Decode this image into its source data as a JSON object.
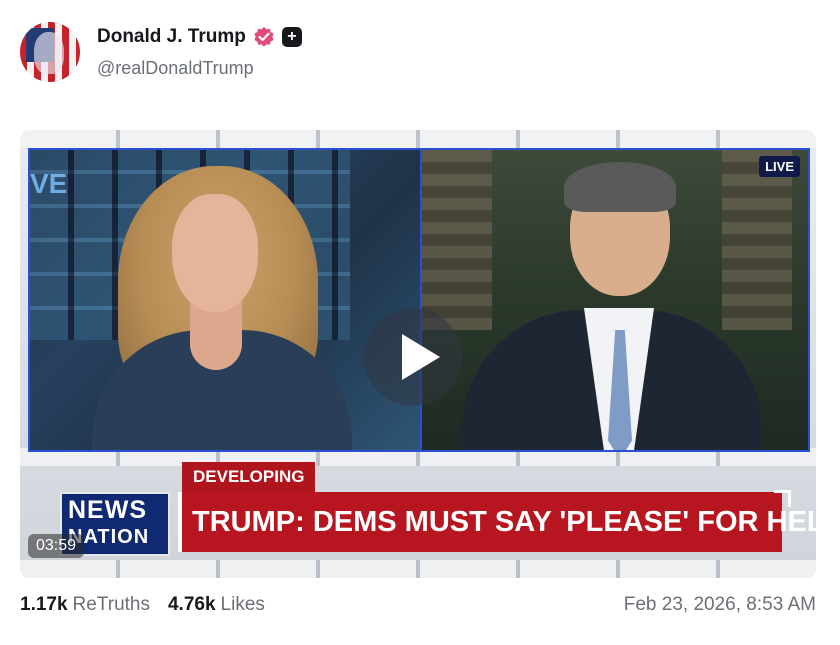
{
  "author": {
    "display_name": "Donald J. Trump",
    "handle": "@realDonaldTrump",
    "verified_icon": "verified-badge-icon",
    "plus_icon": "plus-badge-icon",
    "plus_symbol": "+"
  },
  "video": {
    "duration": "03:59",
    "live_label": "LIVE",
    "logo_line1": "NEWS",
    "logo_line2": "NATION",
    "tag": "DEVELOPING STORY",
    "headline": "TRUMP: DEMS MUST SAY 'PLEASE' FOR HELP",
    "screen_text": "VE",
    "play_icon": "play-icon"
  },
  "stats": {
    "retruths_count": "1.17k",
    "retruths_label": "ReTruths",
    "likes_count": "4.76k",
    "likes_label": "Likes",
    "timestamp": "Feb 23, 2026, 8:53 AM"
  },
  "colors": {
    "verified": "#e24a7a",
    "headline_red": "#b71520",
    "news_blue": "#0f2a73",
    "panel_border": "#2d4fd4"
  }
}
